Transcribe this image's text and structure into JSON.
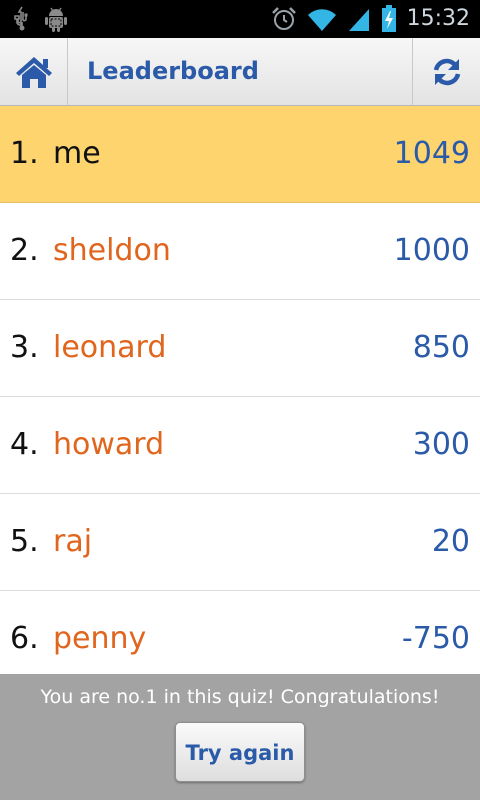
{
  "status_bar": {
    "time": "15:32",
    "icons": [
      "usb-icon",
      "android-debug-icon",
      "alarm-icon",
      "wifi-icon",
      "signal-icon",
      "battery-charging-icon"
    ]
  },
  "action_bar": {
    "title": "Leaderboard",
    "home_icon": "home-icon",
    "refresh_icon": "refresh-icon"
  },
  "leaderboard": [
    {
      "rank": "1.",
      "name": "me",
      "score": "1049",
      "highlighted": true
    },
    {
      "rank": "2.",
      "name": "sheldon",
      "score": "1000",
      "highlighted": false
    },
    {
      "rank": "3.",
      "name": "leonard",
      "score": "850",
      "highlighted": false
    },
    {
      "rank": "4.",
      "name": "howard",
      "score": "300",
      "highlighted": false
    },
    {
      "rank": "5.",
      "name": "raj",
      "score": "20",
      "highlighted": false
    },
    {
      "rank": "6.",
      "name": "penny",
      "score": "-750",
      "highlighted": false
    }
  ],
  "footer": {
    "message": "You are no.1 in this quiz! Congratulations!",
    "button_label": "Try again"
  },
  "colors": {
    "accent_blue": "#2a5aa8",
    "name_orange": "#e0651d",
    "highlight": "#fed46f",
    "footer_gray": "#a3a3a3"
  }
}
